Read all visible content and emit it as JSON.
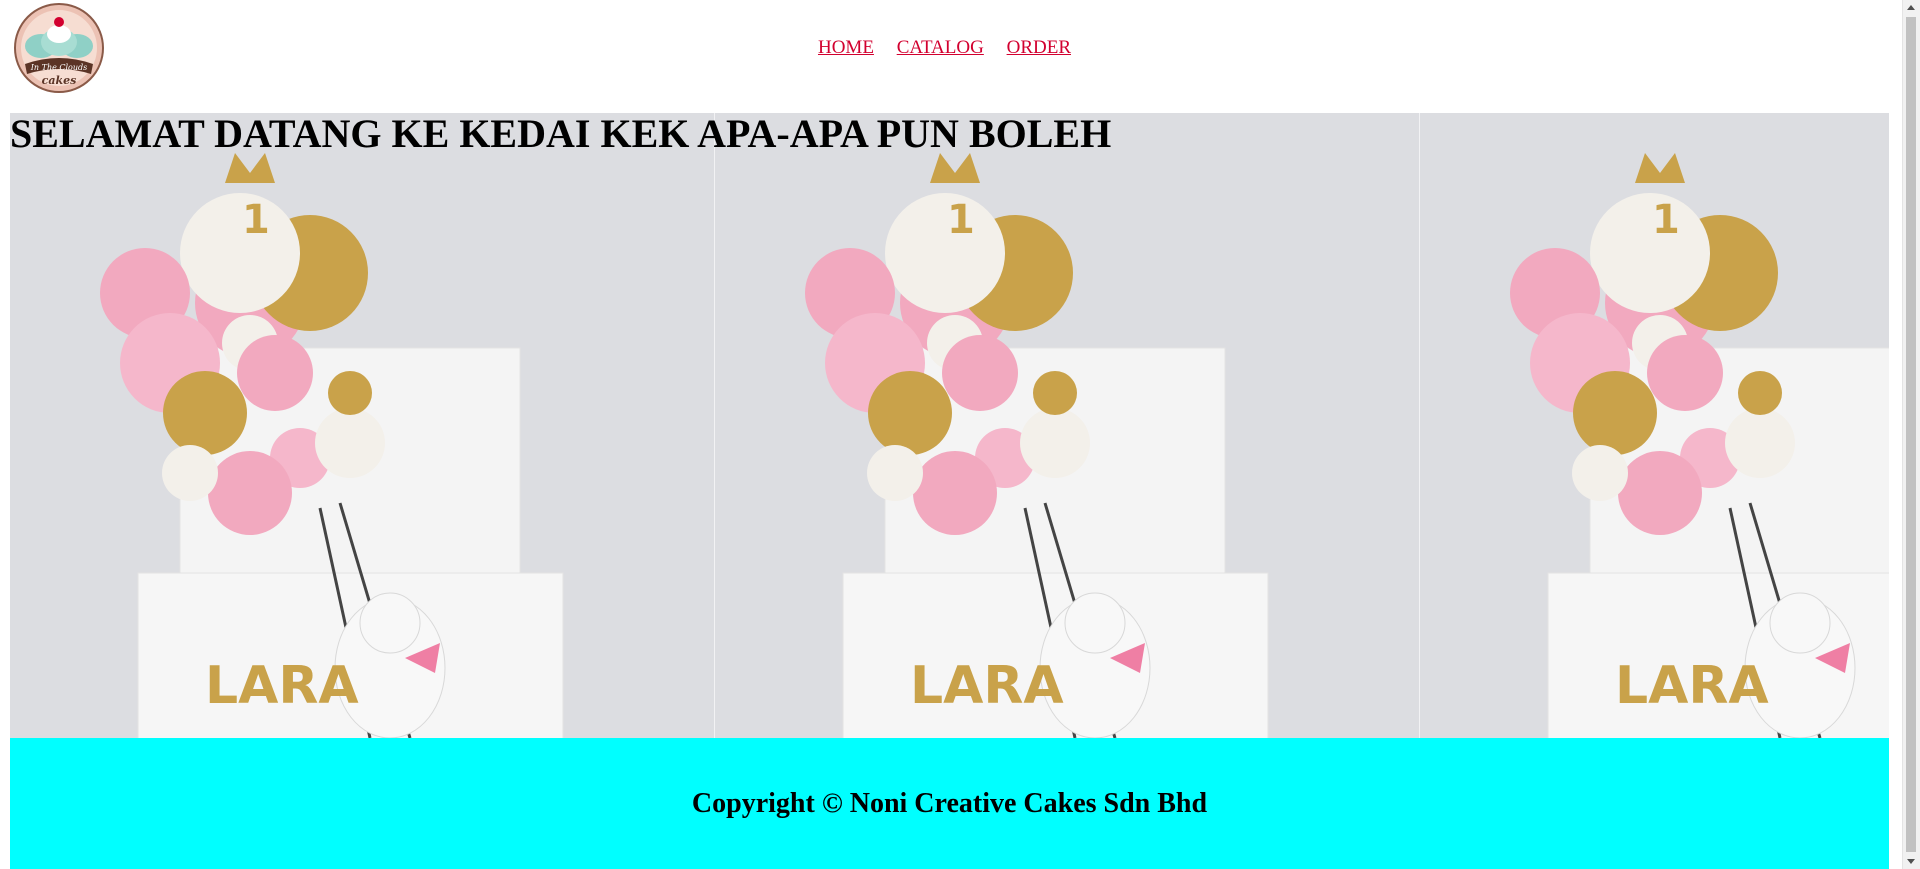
{
  "page": {
    "title": "SELAMAT DATANG KE KEDAI KEK APA-APA PUN BOLEH"
  },
  "logo": {
    "line1": "In The Clouds",
    "line2": "cakes"
  },
  "nav": {
    "items": [
      {
        "label": "HOME"
      },
      {
        "label": "CATALOG"
      },
      {
        "label": "ORDER"
      }
    ]
  },
  "banner": {
    "cake_name": "LARA",
    "topper_number": "1"
  },
  "footer": {
    "text": "Copyright © Noni Creative Cakes Sdn Bhd",
    "background": "#00ffff"
  },
  "colors": {
    "link": "#d2002f",
    "pink": "#f2a9bf",
    "gold": "#c9a24a",
    "cream": "#f3f0ea"
  }
}
